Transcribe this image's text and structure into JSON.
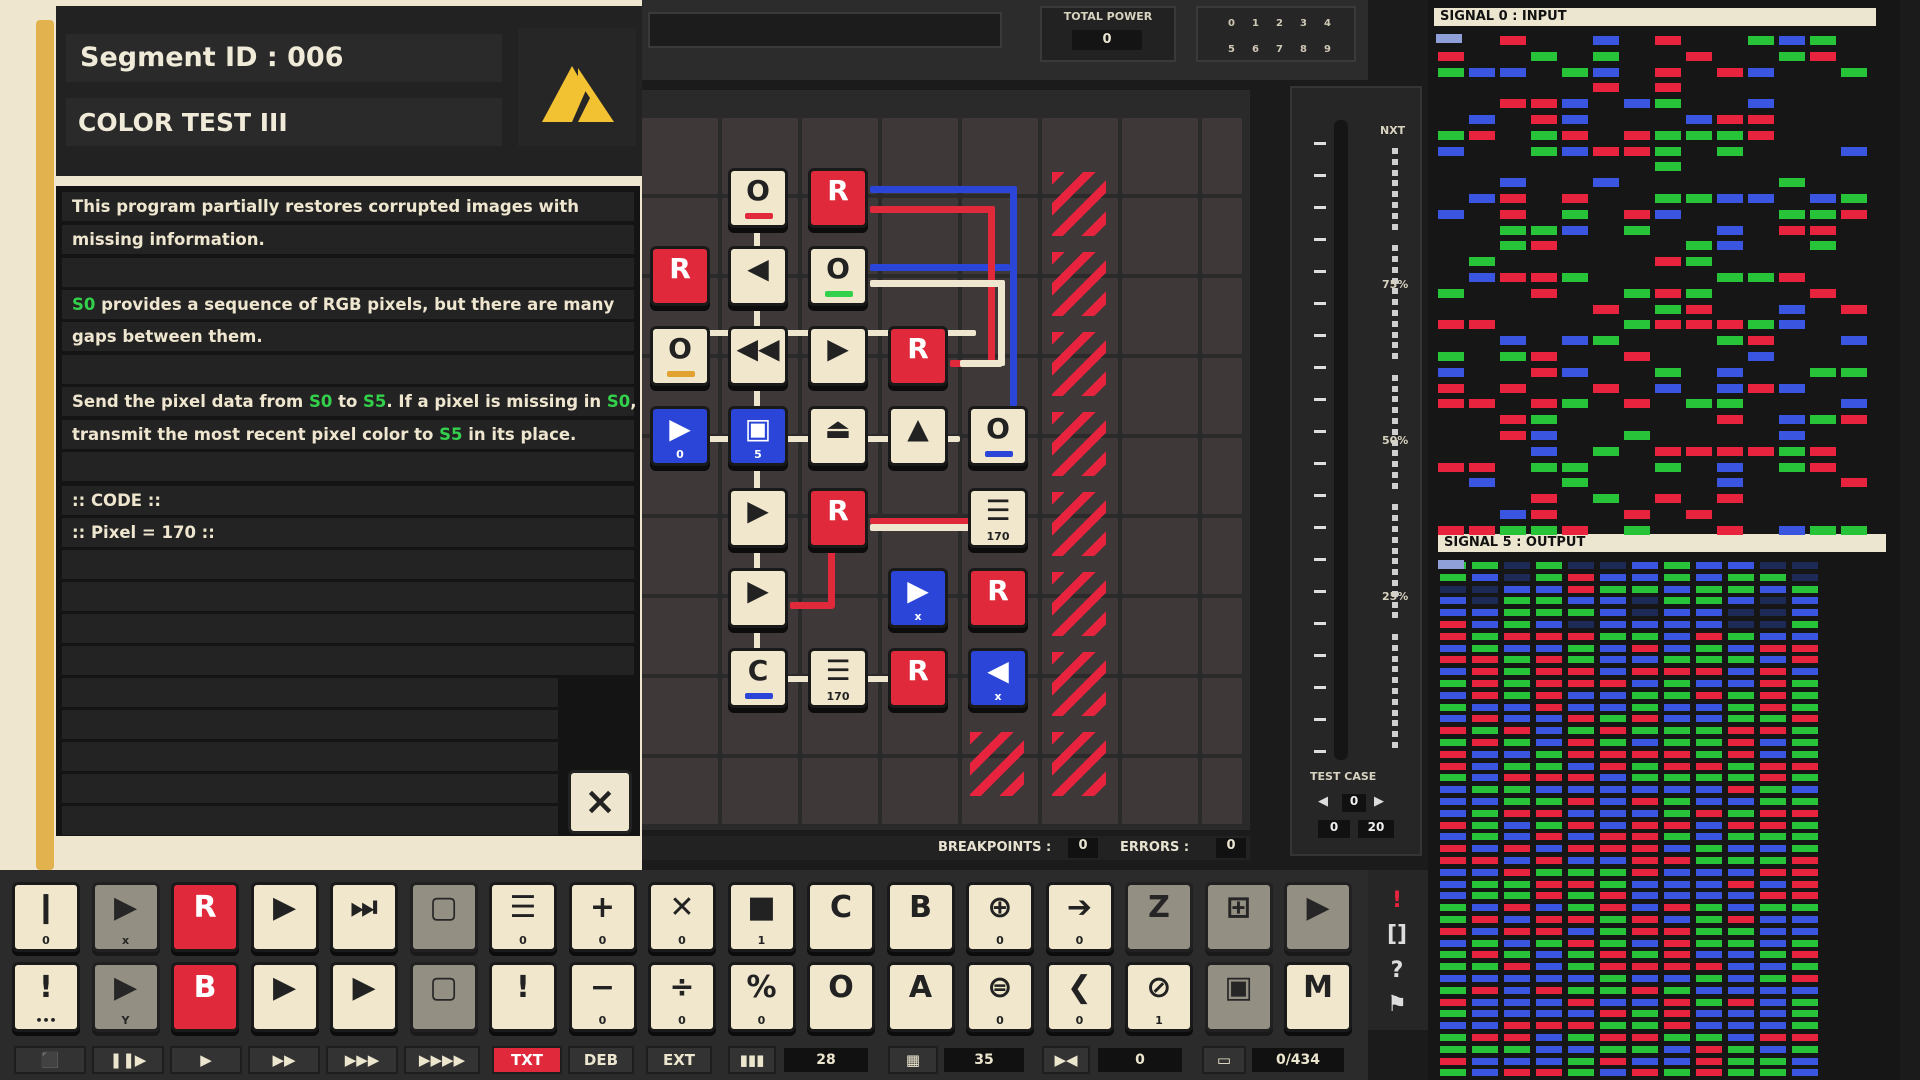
{
  "segment": {
    "id": "Segment ID : 006",
    "name": "COLOR TEST III"
  },
  "description": {
    "lines": [
      [
        "This program partially restores corrupted images with"
      ],
      [
        "missing information."
      ],
      [
        ""
      ],
      [
        "S0",
        " provides a sequence of RGB pixels, but there are many"
      ],
      [
        "gaps between them."
      ],
      [
        ""
      ],
      [
        "Send the pixel data from ",
        "S0",
        " to ",
        "S5",
        ". If a pixel is missing in ",
        "S0",
        ","
      ],
      [
        "transmit the most recent pixel color to ",
        "S5",
        " in its place."
      ],
      [
        ""
      ],
      [
        ":: CODE ::"
      ],
      [
        ":: Pixel = 170 ::"
      ]
    ],
    "highlight_color": "#33d04b"
  },
  "close_label": "×",
  "top": {
    "power_label": "TOTAL POWER",
    "power_value": "0",
    "digits": [
      "0",
      "1",
      "2",
      "3",
      "4",
      "5",
      "6",
      "7",
      "8",
      "9"
    ]
  },
  "status": {
    "breakpoints_label": "BREAKPOINTS :",
    "breakpoints": "0",
    "errors_label": "ERRORS :",
    "errors": "0"
  },
  "speed": {
    "nxt": "NXT",
    "p75": "75%",
    "p50": "50%",
    "p25": "25%"
  },
  "test_case": {
    "label": "TEST CASE",
    "value": "0",
    "range_start": "0",
    "range_end": "20"
  },
  "signals": {
    "input_label": "SIGNAL 0 : INPUT",
    "output_label": "SIGNAL 5 : OUTPUT"
  },
  "board_blocks": [
    {
      "glyph": "O",
      "style": "cream",
      "tag": "#e02a3c",
      "sub": ""
    },
    {
      "glyph": "R",
      "style": "red",
      "tag": "",
      "sub": ""
    },
    {
      "glyph": "R",
      "style": "red",
      "tag": "",
      "sub": ""
    },
    {
      "glyph": "◀",
      "style": "cream",
      "tag": "",
      "sub": ""
    },
    {
      "glyph": "O",
      "style": "cream",
      "tag": "#33d04b",
      "sub": ""
    },
    {
      "glyph": "O",
      "style": "cream",
      "tag": "#e2a230",
      "sub": ""
    },
    {
      "glyph": "◀◀",
      "style": "cream",
      "tag": "",
      "sub": ""
    },
    {
      "glyph": "▶",
      "style": "cream",
      "tag": "",
      "sub": ""
    },
    {
      "glyph": "R",
      "style": "red",
      "tag": "",
      "sub": ""
    },
    {
      "glyph": "▶",
      "style": "blue",
      "tag": "",
      "sub": "0"
    },
    {
      "glyph": "▣",
      "style": "blue",
      "tag": "",
      "sub": "5"
    },
    {
      "glyph": "⏏",
      "style": "cream",
      "tag": "",
      "sub": ""
    },
    {
      "glyph": "▲",
      "style": "cream",
      "tag": "",
      "sub": ""
    },
    {
      "glyph": "O",
      "style": "cream",
      "tag": "#2a45d8",
      "sub": ""
    },
    {
      "glyph": "▶",
      "style": "cream",
      "tag": "",
      "sub": ""
    },
    {
      "glyph": "R",
      "style": "red",
      "tag": "",
      "sub": ""
    },
    {
      "glyph": "☰",
      "style": "cream",
      "tag": "",
      "sub": "170"
    },
    {
      "glyph": "▶",
      "style": "cream",
      "tag": "",
      "sub": ""
    },
    {
      "glyph": "▶",
      "style": "blue",
      "tag": "",
      "sub": "x"
    },
    {
      "glyph": "R",
      "style": "red",
      "tag": "",
      "sub": ""
    },
    {
      "glyph": "C",
      "style": "cream",
      "tag": "#2a45d8",
      "sub": ""
    },
    {
      "glyph": "☰",
      "style": "cream",
      "tag": "",
      "sub": "170"
    },
    {
      "glyph": "R",
      "style": "red",
      "tag": "",
      "sub": ""
    },
    {
      "glyph": "◀",
      "style": "blue",
      "tag": "",
      "sub": "x"
    }
  ],
  "toolbar_row1": [
    {
      "glyph": "❙",
      "sub": "0",
      "style": "cream"
    },
    {
      "glyph": "▶",
      "sub": "x",
      "style": "dim"
    },
    {
      "glyph": "R",
      "sub": "",
      "style": "red"
    },
    {
      "glyph": "▶",
      "sub": "",
      "style": "cream"
    },
    {
      "glyph": "⏭",
      "sub": "",
      "style": "cream"
    },
    {
      "glyph": "▢",
      "sub": "",
      "style": "dim"
    },
    {
      "glyph": "☰",
      "sub": "0",
      "style": "cream"
    },
    {
      "glyph": "+",
      "sub": "0",
      "style": "cream"
    },
    {
      "glyph": "✕",
      "sub": "0",
      "style": "cream"
    },
    {
      "glyph": "■",
      "sub": "1",
      "style": "cream"
    },
    {
      "glyph": "C",
      "sub": "",
      "style": "cream"
    },
    {
      "glyph": "B",
      "sub": "",
      "style": "cream"
    },
    {
      "glyph": "⊕",
      "sub": "0",
      "style": "cream"
    },
    {
      "glyph": "➔",
      "sub": "0",
      "style": "cream"
    },
    {
      "glyph": "Z",
      "sub": "",
      "style": "dim"
    },
    {
      "glyph": "⊞",
      "sub": "",
      "style": "dim"
    },
    {
      "glyph": "▶",
      "sub": "",
      "style": "dim"
    }
  ],
  "toolbar_row2": [
    {
      "glyph": "!",
      "sub": "•••",
      "style": "cream"
    },
    {
      "glyph": "▶",
      "sub": "Y",
      "style": "dim"
    },
    {
      "glyph": "B",
      "sub": "",
      "style": "red"
    },
    {
      "glyph": "▶",
      "sub": "",
      "style": "cream"
    },
    {
      "glyph": "▶",
      "sub": "",
      "style": "cream"
    },
    {
      "glyph": "▢",
      "sub": "",
      "style": "dim"
    },
    {
      "glyph": "!",
      "sub": "",
      "style": "cream"
    },
    {
      "glyph": "−",
      "sub": "0",
      "style": "cream"
    },
    {
      "glyph": "÷",
      "sub": "0",
      "style": "cream"
    },
    {
      "glyph": "%",
      "sub": "0",
      "style": "cream"
    },
    {
      "glyph": "O",
      "sub": "",
      "style": "cream"
    },
    {
      "glyph": "A",
      "sub": "",
      "style": "cream"
    },
    {
      "glyph": "⊜",
      "sub": "0",
      "style": "cream"
    },
    {
      "glyph": "❮",
      "sub": "0",
      "style": "cream"
    },
    {
      "glyph": "⊘",
      "sub": "1",
      "style": "cream"
    },
    {
      "glyph": "▣",
      "sub": "",
      "style": "dim"
    },
    {
      "glyph": "M",
      "sub": "",
      "style": "cream"
    }
  ],
  "bottom_bar": {
    "txt": "TXT",
    "deb": "DEB",
    "ext": "EXT",
    "count_a": "28",
    "count_b": "35",
    "count_c": "0",
    "count_d": "0/434"
  },
  "signal_colors": {
    "red": "#e8233d",
    "green": "#27c43a",
    "blue": "#3a55e0",
    "empty": "#1d2a55"
  }
}
